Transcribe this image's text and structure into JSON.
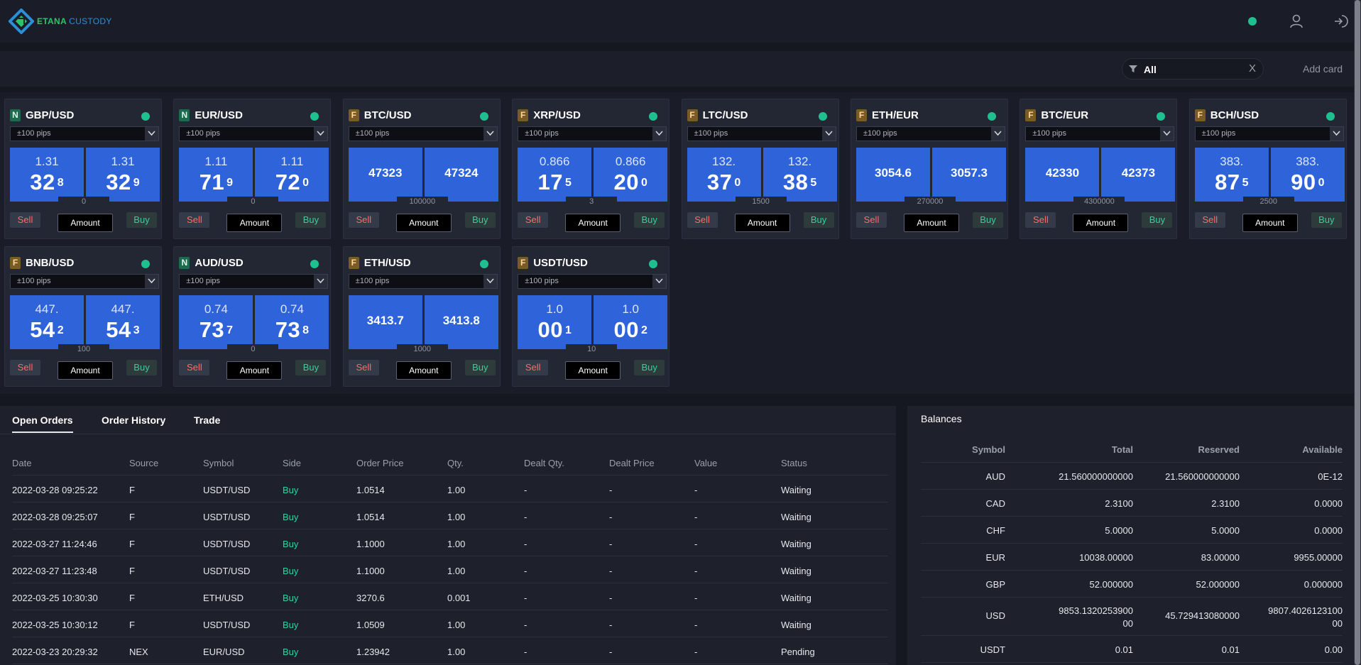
{
  "brand": {
    "part1": "ETANA",
    "part2": "CUSTODY"
  },
  "header": {
    "status_color": "#1fc08f",
    "icons": [
      "user-icon",
      "logout-icon"
    ]
  },
  "filter": {
    "value": "All",
    "clear": "X",
    "add_card": "Add card"
  },
  "colors": {
    "price_tile": "#2f63d9",
    "sell": "#ff6b6b",
    "buy": "#33d29b",
    "online": "#1fc08f"
  },
  "cards": [
    {
      "badge": "N",
      "pair": "GBP/USD",
      "pips": "±100 pips",
      "sell_top": "1.31",
      "sell_main": "32",
      "sell_sup": "8",
      "buy_top": "1.31",
      "buy_main": "32",
      "buy_sup": "9",
      "spread": "0",
      "sell": "Sell",
      "buy": "Buy",
      "amount": "Amount"
    },
    {
      "badge": "N",
      "pair": "EUR/USD",
      "pips": "±100 pips",
      "sell_top": "1.11",
      "sell_main": "71",
      "sell_sup": "9",
      "buy_top": "1.11",
      "buy_main": "72",
      "buy_sup": "0",
      "spread": "0",
      "sell": "Sell",
      "buy": "Buy",
      "amount": "Amount"
    },
    {
      "badge": "F",
      "pair": "BTC/USD",
      "pips": "±100 pips",
      "sell_flat": "47323",
      "buy_flat": "47324",
      "spread": "100000",
      "sell": "Sell",
      "buy": "Buy",
      "amount": "Amount"
    },
    {
      "badge": "F",
      "pair": "XRP/USD",
      "pips": "±100 pips",
      "sell_top": "0.866",
      "sell_main": "17",
      "sell_sup": "5",
      "buy_top": "0.866",
      "buy_main": "20",
      "buy_sup": "0",
      "spread": "3",
      "sell": "Sell",
      "buy": "Buy",
      "amount": "Amount"
    },
    {
      "badge": "F",
      "pair": "LTC/USD",
      "pips": "±100 pips",
      "sell_top": "132.",
      "sell_main": "37",
      "sell_sup": "0",
      "buy_top": "132.",
      "buy_main": "38",
      "buy_sup": "5",
      "spread": "1500",
      "sell": "Sell",
      "buy": "Buy",
      "amount": "Amount"
    },
    {
      "badge": "F",
      "pair": "ETH/EUR",
      "pips": "±100 pips",
      "sell_flat": "3054.6",
      "buy_flat": "3057.3",
      "spread": "270000",
      "sell": "Sell",
      "buy": "Buy",
      "amount": "Amount"
    },
    {
      "badge": "F",
      "pair": "BTC/EUR",
      "pips": "±100 pips",
      "sell_flat": "42330",
      "buy_flat": "42373",
      "spread": "4300000",
      "sell": "Sell",
      "buy": "Buy",
      "amount": "Amount"
    },
    {
      "badge": "F",
      "pair": "BCH/USD",
      "pips": "±100 pips",
      "sell_top": "383.",
      "sell_main": "87",
      "sell_sup": "5",
      "buy_top": "383.",
      "buy_main": "90",
      "buy_sup": "0",
      "spread": "2500",
      "sell": "Sell",
      "buy": "Buy",
      "amount": "Amount"
    },
    {
      "badge": "F",
      "pair": "BNB/USD",
      "pips": "±100 pips",
      "sell_top": "447.",
      "sell_main": "54",
      "sell_sup": "2",
      "buy_top": "447.",
      "buy_main": "54",
      "buy_sup": "3",
      "spread": "100",
      "sell": "Sell",
      "buy": "Buy",
      "amount": "Amount"
    },
    {
      "badge": "N",
      "pair": "AUD/USD",
      "pips": "±100 pips",
      "sell_top": "0.74",
      "sell_main": "73",
      "sell_sup": "7",
      "buy_top": "0.74",
      "buy_main": "73",
      "buy_sup": "8",
      "spread": "0",
      "sell": "Sell",
      "buy": "Buy",
      "amount": "Amount"
    },
    {
      "badge": "F",
      "pair": "ETH/USD",
      "pips": "±100 pips",
      "sell_flat": "3413.7",
      "buy_flat": "3413.8",
      "spread": "1000",
      "sell": "Sell",
      "buy": "Buy",
      "amount": "Amount"
    },
    {
      "badge": "F",
      "pair": "USDT/USD",
      "pips": "±100 pips",
      "sell_top": "1.0",
      "sell_main": "00",
      "sell_sup": "1",
      "buy_top": "1.0",
      "buy_main": "00",
      "buy_sup": "2",
      "spread": "10",
      "sell": "Sell",
      "buy": "Buy",
      "amount": "Amount"
    }
  ],
  "orders": {
    "tabs": [
      "Open Orders",
      "Order History",
      "Trade"
    ],
    "active_tab": "Open Orders",
    "columns": [
      "Date",
      "Source",
      "Symbol",
      "Side",
      "Order Price",
      "Qty.",
      "Dealt Qty.",
      "Dealt Price",
      "Value",
      "Status"
    ],
    "rows": [
      [
        "2022-03-28 09:25:22",
        "F",
        "USDT/USD",
        "Buy",
        "1.0514",
        "1.00",
        "-",
        "-",
        "-",
        "Waiting"
      ],
      [
        "2022-03-28 09:25:07",
        "F",
        "USDT/USD",
        "Buy",
        "1.0514",
        "1.00",
        "-",
        "-",
        "-",
        "Waiting"
      ],
      [
        "2022-03-27 11:24:46",
        "F",
        "USDT/USD",
        "Buy",
        "1.1000",
        "1.00",
        "-",
        "-",
        "-",
        "Waiting"
      ],
      [
        "2022-03-27 11:23:48",
        "F",
        "USDT/USD",
        "Buy",
        "1.1000",
        "1.00",
        "-",
        "-",
        "-",
        "Waiting"
      ],
      [
        "2022-03-25 10:30:30",
        "F",
        "ETH/USD",
        "Buy",
        "3270.6",
        "0.001",
        "-",
        "-",
        "-",
        "Waiting"
      ],
      [
        "2022-03-25 10:30:12",
        "F",
        "USDT/USD",
        "Buy",
        "1.0509",
        "1.00",
        "-",
        "-",
        "-",
        "Waiting"
      ],
      [
        "2022-03-23 20:29:32",
        "NEX",
        "EUR/USD",
        "Buy",
        "1.23942",
        "1.00",
        "-",
        "-",
        "-",
        "Pending"
      ]
    ]
  },
  "balances": {
    "title": "Balances",
    "columns": [
      "Symbol",
      "Total",
      "Reserved",
      "Available"
    ],
    "rows": [
      [
        "AUD",
        "21.560000000000",
        "21.560000000000",
        "0E-12"
      ],
      [
        "CAD",
        "2.3100",
        "2.3100",
        "0.0000"
      ],
      [
        "CHF",
        "5.0000",
        "5.0000",
        "0.0000"
      ],
      [
        "EUR",
        "10038.00000",
        "83.00000",
        "9955.00000"
      ],
      [
        "GBP",
        "52.000000",
        "52.000000",
        "0.000000"
      ],
      [
        "USD",
        "9853.1320253900 00",
        "45.729413080000",
        "9807.4026123100 00"
      ],
      [
        "USDT",
        "0.01",
        "0.01",
        "0.00"
      ]
    ]
  }
}
